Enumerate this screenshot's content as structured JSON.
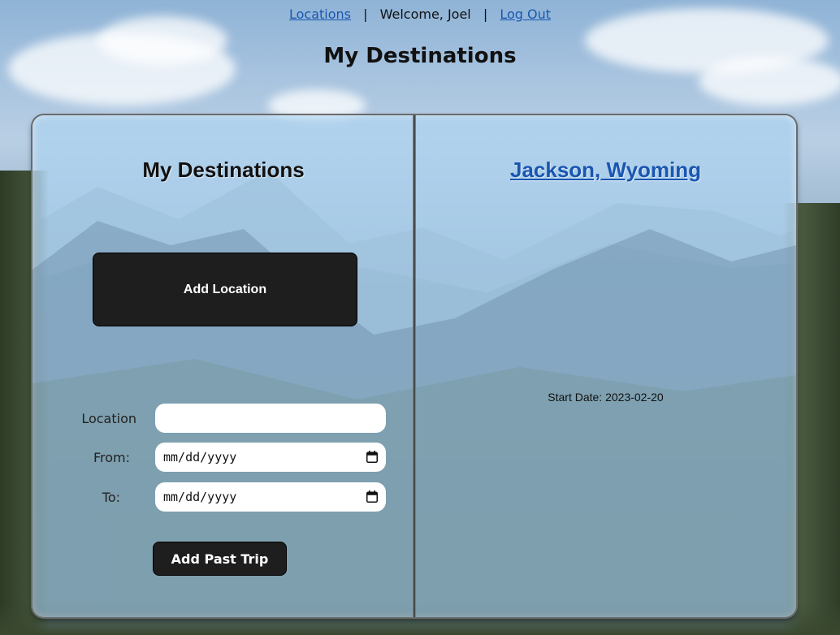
{
  "nav": {
    "locations_link": "Locations",
    "separator": "|",
    "welcome": "Welcome, Joel",
    "logout_link": "Log Out"
  },
  "page_title": "My Destinations",
  "left_page": {
    "heading": "My Destinations",
    "add_location_button": "Add Location",
    "form": {
      "location_label": "Location",
      "location_value": "",
      "from_label": "From:",
      "from_value": "mm/dd/yyyy",
      "to_label": "To:",
      "to_value": "mm/dd/yyyy",
      "submit_button": "Add Past Trip"
    }
  },
  "right_page": {
    "destination_link": "Jackson, Wyoming",
    "start_date": "Start Date: 2023-02-20"
  },
  "colors": {
    "link": "#1a56b0",
    "button_bg": "#1e1e1e",
    "book_bg": "#add2f0"
  },
  "icons": {
    "calendar": "calendar-icon"
  }
}
